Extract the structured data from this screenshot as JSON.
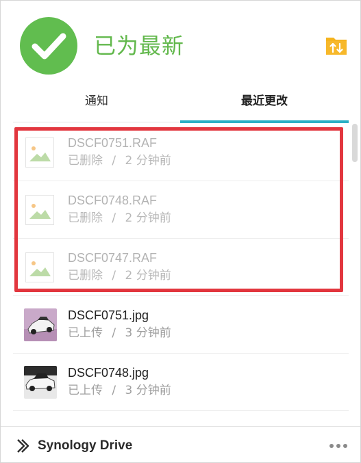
{
  "header": {
    "status_title": "已为最新",
    "status_color": "#61bd4f"
  },
  "tabs": [
    {
      "label": "通知",
      "active": false
    },
    {
      "label": "最近更改",
      "active": true
    }
  ],
  "files": [
    {
      "name": "DSCF0751.RAF",
      "status": "已删除",
      "time": "2 分钟前",
      "thumb": "image-placeholder-icon",
      "deleted": true
    },
    {
      "name": "DSCF0748.RAF",
      "status": "已删除",
      "time": "2 分钟前",
      "thumb": "image-placeholder-icon",
      "deleted": true
    },
    {
      "name": "DSCF0747.RAF",
      "status": "已删除",
      "time": "2 分钟前",
      "thumb": "image-placeholder-icon",
      "deleted": true
    },
    {
      "name": "DSCF0751.jpg",
      "status": "已上传",
      "time": "3 分钟前",
      "thumb": "car-photo-thumbnail",
      "deleted": false
    },
    {
      "name": "DSCF0748.jpg",
      "status": "已上传",
      "time": "3 分钟前",
      "thumb": "car-photo-thumbnail",
      "deleted": false
    }
  ],
  "separator": "/",
  "footer": {
    "brand": "Synology Drive"
  },
  "colors": {
    "accent": "#2bafc4",
    "highlight": "#e2363e",
    "folder": "#f5b31d"
  }
}
